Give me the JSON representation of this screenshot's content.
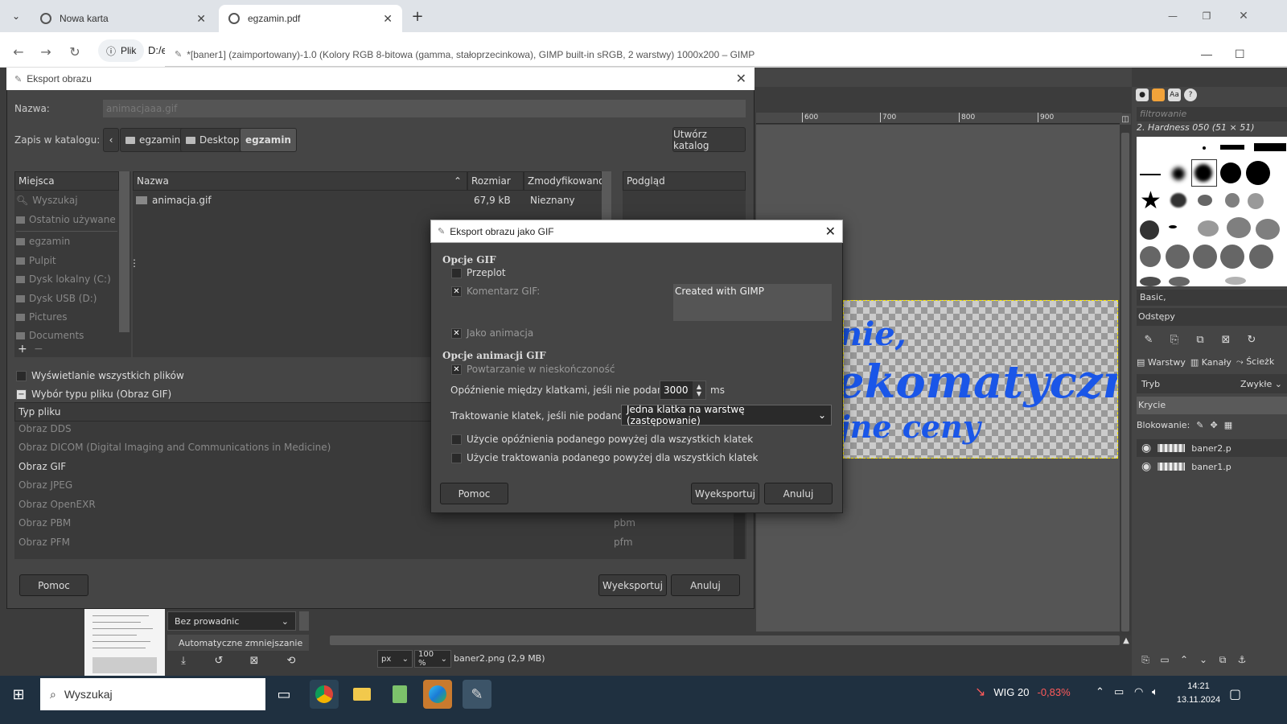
{
  "browser": {
    "tabs": [
      {
        "title": "Nowa karta",
        "active": false
      },
      {
        "title": "egzamin.pdf",
        "active": true
      }
    ],
    "site_label": "Plik",
    "url_fragment": "D:/e"
  },
  "gimp": {
    "window_title": "*[baner1] (zaimportowany)-1.0 (Kolory RGB 8-bitowa (gamma, stałoprzecinkowa), GIMP built-in sRGB, 2 warstwy) 1000x200 – GIMP",
    "ruler_labels": [
      "600",
      "700",
      "800",
      "900"
    ],
    "banner_lines": [
      "nie,",
      "ekomatyczne",
      "jne ceny"
    ],
    "status": {
      "unit": "px",
      "zoom": "100 %",
      "file": "baner2.png (2,9 MB)"
    },
    "left_dock": {
      "guides": "Bez prowadnic",
      "auto_shrink": "Automatyczne zmniejszanie"
    },
    "right_dock": {
      "filter_placeholder": "filtrowanie",
      "brush_name": "2. Hardness 050 (51 × 51)",
      "tag": "Basic,",
      "spacing_label": "Odstępy",
      "tabs": [
        "Warstwy",
        "Kanały",
        "Ścieżk"
      ],
      "mode_label": "Tryb",
      "mode_value": "Zwykłe",
      "opacity_label": "Krycie",
      "lock_label": "Blokowanie:",
      "layers": [
        "baner2.p",
        "baner1.p"
      ]
    }
  },
  "export_dialog": {
    "title": "Eksport obrazu",
    "name_label": "Nazwa:",
    "name_value": "animacjaaa.gif",
    "folder_label": "Zapis w katalogu:",
    "breadcrumbs": [
      "egzamin",
      "Desktop",
      "egzamin"
    ],
    "create_folder": "Utwórz katalog",
    "places_header": "Miejsca",
    "places": [
      "Wyszukaj",
      "Ostatnio używane",
      "egzamin",
      "Pulpit",
      "Dysk lokalny (C:)",
      "Dysk USB (D:)",
      "Pictures",
      "Documents"
    ],
    "columns": {
      "name": "Nazwa",
      "size": "Rozmiar",
      "modified": "Zmodyfikowano"
    },
    "files": [
      {
        "name": "animacja.gif",
        "size": "67,9 kB",
        "modified": "Nieznany"
      }
    ],
    "preview_header": "Podgląd",
    "show_all_files": "Wyświetlanie wszystkich plików",
    "file_type_select": "Wybór typu pliku (Obraz GIF)",
    "type_header": "Typ pliku",
    "file_types": [
      {
        "name": "Obraz DDS",
        "ext": ""
      },
      {
        "name": "Obraz DICOM (Digital Imaging and Communications in Medicine)",
        "ext": ""
      },
      {
        "name": "Obraz GIF",
        "ext": ""
      },
      {
        "name": "Obraz JPEG",
        "ext": ""
      },
      {
        "name": "Obraz OpenEXR",
        "ext": ""
      },
      {
        "name": "Obraz PBM",
        "ext": "pbm"
      },
      {
        "name": "Obraz PFM",
        "ext": "pfm"
      }
    ],
    "help_button": "Pomoc",
    "export_button": "Wyeksportuj",
    "cancel_button": "Anuluj"
  },
  "gif_dialog": {
    "title": "Eksport obrazu jako GIF",
    "section_options": "Opcje GIF",
    "interlace": {
      "label": "Przeplot",
      "checked": false
    },
    "gif_comment": {
      "label": "Komentarz GIF:",
      "checked": true
    },
    "comment_text": "Created with GIMP",
    "as_animation": {
      "label": "Jako animacja",
      "checked": true
    },
    "section_animation": "Opcje animacji GIF",
    "loop_forever": {
      "label": "Powtarzanie w nieskończoność",
      "checked": true
    },
    "delay_label": "Opóźnienie między klatkami, jeśli nie podano:",
    "delay_value": "3000",
    "delay_unit": "ms",
    "frame_disposal_label": "Traktowanie klatek, jeśli nie podano:",
    "frame_disposal_value": "Jedna klatka na warstwę (zastępowanie)",
    "use_delay_all": {
      "label": "Użycie opóźnienia podanego powyżej dla wszystkich klatek",
      "checked": false
    },
    "use_disposal_all": {
      "label": "Użycie traktowania podanego powyżej dla wszystkich klatek",
      "checked": false
    },
    "help_button": "Pomoc",
    "export_button": "Wyeksportuj",
    "cancel_button": "Anuluj"
  },
  "taskbar": {
    "search_placeholder": "Wyszukaj",
    "stock_name": "WIG 20",
    "stock_change": "-0,83%",
    "time": "14:21",
    "date": "13.11.2024"
  }
}
